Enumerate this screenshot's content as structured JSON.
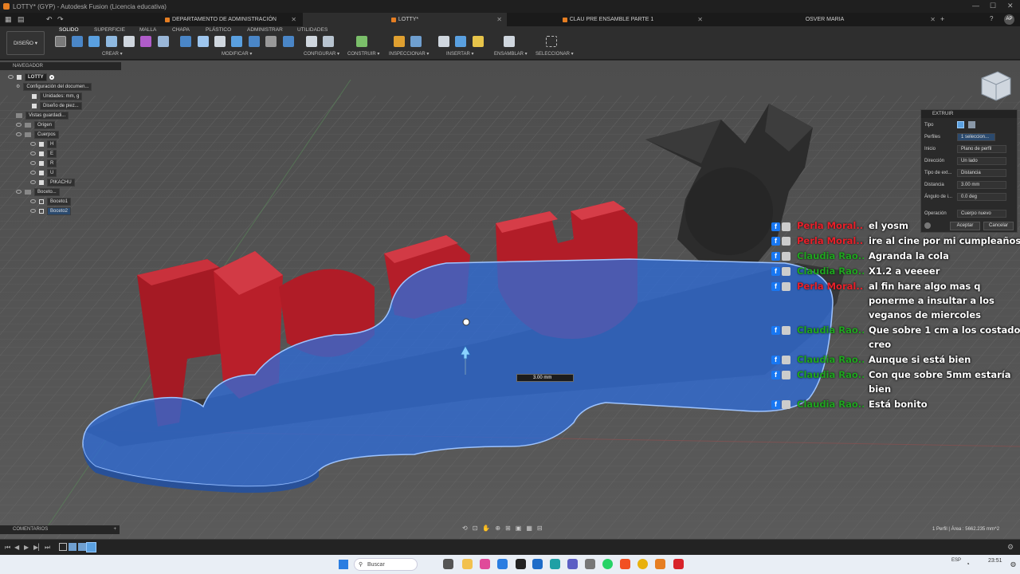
{
  "window": {
    "title": "LOTTY* (GYP) - Autodesk Fusion (Licencia educativa)"
  },
  "doc_tabs": [
    {
      "label": "DEPARTAMENTO DE ADMINISTRACIÓN"
    },
    {
      "label": "LOTTY*"
    },
    {
      "label": "CLAU PRE ENSAMBLE PARTE 1"
    },
    {
      "label": "OSVER MARIA"
    }
  ],
  "user_initials": "AP",
  "workspace": "DISEÑO",
  "ribbon_tabs": [
    "SOLIDO",
    "SUPERFICIE",
    "MALLA",
    "CHAPA",
    "PLÁSTICO",
    "ADMINISTRAR",
    "UTILIDADES"
  ],
  "ribbon_groups": [
    "CREAR",
    "MODIFICAR",
    "CONFIGURAR",
    "CONSTRUIR",
    "INSPECCIONAR",
    "INSERTAR",
    "ENSAMBLAR",
    "SELECCIONAR"
  ],
  "navigator": {
    "title": "NAVEGADOR",
    "items": [
      {
        "label": "LOTTY"
      },
      {
        "label": "Configuración del documen..."
      },
      {
        "label": "Unidades: mm, g"
      },
      {
        "label": "Diseño de piez..."
      },
      {
        "label": "Vistas guardadi..."
      },
      {
        "label": "Origen"
      },
      {
        "label": "Cuerpos"
      },
      {
        "label": "H"
      },
      {
        "label": "E"
      },
      {
        "label": "R"
      },
      {
        "label": "U"
      },
      {
        "label": "PIKACHU"
      },
      {
        "label": "Boceto..."
      },
      {
        "label": "Boceto1"
      },
      {
        "label": "Boceto2"
      }
    ]
  },
  "comments_label": "COMENTARIOS",
  "extrude": {
    "title": "EXTRUIR",
    "rows": [
      {
        "label": "Tipo",
        "value": ""
      },
      {
        "label": "Perfiles",
        "value": "1 seleccion..."
      },
      {
        "label": "Inicio",
        "value": "Plano de perfil"
      },
      {
        "label": "Dirección",
        "value": "Un lado"
      },
      {
        "label": "Tipo de ext...",
        "value": "Distancia"
      },
      {
        "label": "Distancia",
        "value": "3.00 mm"
      },
      {
        "label": "Ángulo de i...",
        "value": "0.0 deg"
      },
      {
        "label": "Operación",
        "value": "Cuerpo nuevo"
      }
    ],
    "ok": "Aceptar",
    "cancel": "Cancelar"
  },
  "canvas": {
    "dimension_input": "3.00 mm",
    "status": "1 Perfil | Área : 5662.235 mm^2"
  },
  "chat": [
    {
      "name": "Perla Moral...",
      "name_color": "#e8202a",
      "text": "el yosm"
    },
    {
      "name": "Perla Moral...",
      "name_color": "#e8202a",
      "text": "ire al cine por mi cumpleaños"
    },
    {
      "name": "Claudia Rao...",
      "name_color": "#1fa51f",
      "text": "Agranda la cola"
    },
    {
      "name": "Claudia Rao...",
      "name_color": "#1fa51f",
      "text": "X1.2 a veeeer"
    },
    {
      "name": "Perla Moral...",
      "name_color": "#e8202a",
      "text": "al fin hare algo mas q"
    },
    {
      "name": "",
      "name_color": "",
      "text": "ponerme a insultar a los"
    },
    {
      "name": "",
      "name_color": "",
      "text": "veganos de miercoles"
    },
    {
      "name": "Claudia Rao...",
      "name_color": "#1fa51f",
      "text": "Que sobre 1 cm a los costados"
    },
    {
      "name": "",
      "name_color": "",
      "text": "creo"
    },
    {
      "name": "Claudia Rao...",
      "name_color": "#1fa51f",
      "text": "Aunque si está bien"
    },
    {
      "name": "Claudia Rao...",
      "name_color": "#1fa51f",
      "text": "Con que sobre 5mm estaría"
    },
    {
      "name": "",
      "name_color": "",
      "text": "bien"
    },
    {
      "name": "Claudia Rao...",
      "name_color": "#1fa51f",
      "text": "Está bonito"
    }
  ],
  "taskbar": {
    "search_placeholder": "Buscar",
    "time": "23:51",
    "lang": "ESP"
  }
}
